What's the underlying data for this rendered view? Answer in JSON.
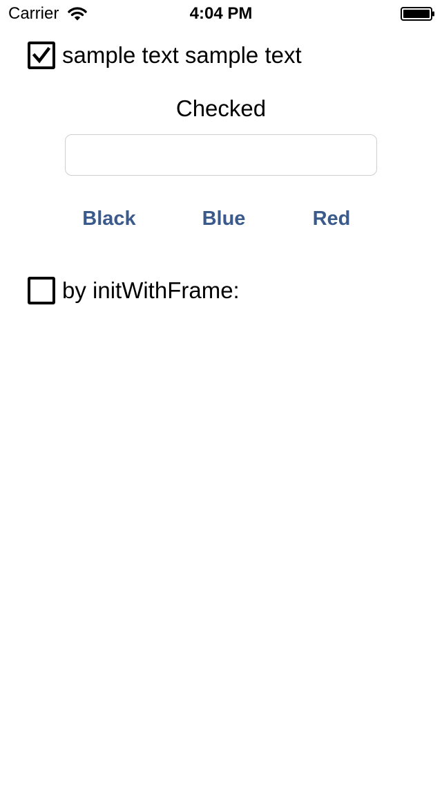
{
  "status_bar": {
    "carrier": "Carrier",
    "time": "4:04 PM",
    "icons": [
      "wifi-icon",
      "battery-icon"
    ]
  },
  "checkbox_top": {
    "label": "sample text sample text",
    "checked": true
  },
  "status_label": "Checked",
  "text_field": {
    "value": "",
    "placeholder": ""
  },
  "color_buttons": [
    {
      "label": "Black"
    },
    {
      "label": "Blue"
    },
    {
      "label": "Red"
    }
  ],
  "checkbox_bottom": {
    "label": "by initWithFrame:",
    "checked": false
  },
  "colors": {
    "button_text": "#3b5a8c",
    "text": "#000000",
    "background": "#ffffff",
    "field_border": "#cfcfcf"
  }
}
